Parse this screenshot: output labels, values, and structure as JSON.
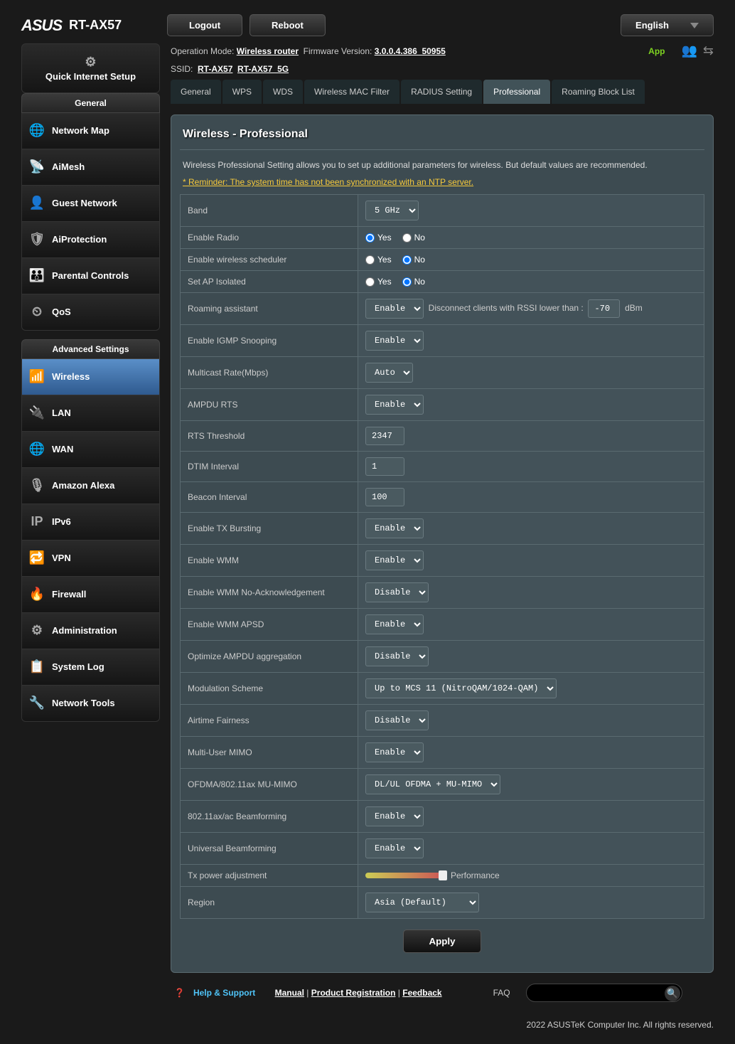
{
  "header": {
    "brand": "ASUS",
    "model": "RT-AX57",
    "logout": "Logout",
    "reboot": "Reboot",
    "language": "English"
  },
  "status": {
    "operation_mode_label": "Operation Mode:",
    "operation_mode": "Wireless router",
    "firmware_label": "Firmware Version:",
    "firmware": "3.0.0.4.386_50955",
    "ssid_label": "SSID:",
    "ssid1": "RT-AX57",
    "ssid2": "RT-AX57_5G",
    "app": "App"
  },
  "sidebar": {
    "qis": "Quick Internet Setup",
    "general_label": "General",
    "general": [
      {
        "label": "Network Map",
        "icon": "🌐"
      },
      {
        "label": "AiMesh",
        "icon": "📡"
      },
      {
        "label": "Guest Network",
        "icon": "👤"
      },
      {
        "label": "AiProtection",
        "icon": "🛡"
      },
      {
        "label": "Parental Controls",
        "icon": "👪"
      },
      {
        "label": "QoS",
        "icon": "⏲"
      }
    ],
    "advanced_label": "Advanced Settings",
    "advanced": [
      {
        "label": "Wireless",
        "icon": "📶",
        "active": true
      },
      {
        "label": "LAN",
        "icon": "🔌"
      },
      {
        "label": "WAN",
        "icon": "🌐"
      },
      {
        "label": "Amazon Alexa",
        "icon": "🎙"
      },
      {
        "label": "IPv6",
        "icon": "IP"
      },
      {
        "label": "VPN",
        "icon": "🔁"
      },
      {
        "label": "Firewall",
        "icon": "🔥"
      },
      {
        "label": "Administration",
        "icon": "⚙"
      },
      {
        "label": "System Log",
        "icon": "📋"
      },
      {
        "label": "Network Tools",
        "icon": "🔧"
      }
    ]
  },
  "tabs": [
    "General",
    "WPS",
    "WDS",
    "Wireless MAC Filter",
    "RADIUS Setting",
    "Professional",
    "Roaming Block List"
  ],
  "active_tab": 5,
  "panel": {
    "title": "Wireless - Professional",
    "description": "Wireless Professional Setting allows you to set up additional parameters for wireless. But default values are recommended.",
    "reminder": "* Reminder: The system time has not been synchronized with an NTP server."
  },
  "settings": {
    "band": {
      "label": "Band",
      "value": "5 GHz"
    },
    "enable_radio": {
      "label": "Enable Radio",
      "yes": "Yes",
      "no": "No",
      "value": "yes"
    },
    "enable_scheduler": {
      "label": "Enable wireless scheduler",
      "yes": "Yes",
      "no": "No",
      "value": "no"
    },
    "ap_isolated": {
      "label": "Set AP Isolated",
      "yes": "Yes",
      "no": "No",
      "value": "no"
    },
    "roaming": {
      "label": "Roaming assistant",
      "value": "Enable",
      "disconnect_text": "Disconnect clients with RSSI lower than :",
      "rssi": "-70",
      "unit": "dBm"
    },
    "igmp": {
      "label": "Enable IGMP Snooping",
      "value": "Enable"
    },
    "multicast": {
      "label": "Multicast Rate(Mbps)",
      "value": "Auto"
    },
    "ampdu_rts": {
      "label": "AMPDU RTS",
      "value": "Enable"
    },
    "rts_threshold": {
      "label": "RTS Threshold",
      "value": "2347"
    },
    "dtim": {
      "label": "DTIM Interval",
      "value": "1"
    },
    "beacon": {
      "label": "Beacon Interval",
      "value": "100"
    },
    "tx_bursting": {
      "label": "Enable TX Bursting",
      "value": "Enable"
    },
    "wmm": {
      "label": "Enable WMM",
      "value": "Enable"
    },
    "wmm_noack": {
      "label": "Enable WMM No-Acknowledgement",
      "value": "Disable"
    },
    "wmm_apsd": {
      "label": "Enable WMM APSD",
      "value": "Enable"
    },
    "ampdu_agg": {
      "label": "Optimize AMPDU aggregation",
      "value": "Disable"
    },
    "modulation": {
      "label": "Modulation Scheme",
      "value": "Up to MCS 11 (NitroQAM/1024-QAM)"
    },
    "airtime": {
      "label": "Airtime Fairness",
      "value": "Disable"
    },
    "mu_mimo": {
      "label": "Multi-User MIMO",
      "value": "Enable"
    },
    "ofdma": {
      "label": "OFDMA/802.11ax MU-MIMO",
      "value": "DL/UL OFDMA + MU-MIMO"
    },
    "beamforming": {
      "label": "802.11ax/ac Beamforming",
      "value": "Enable"
    },
    "universal_bf": {
      "label": "Universal Beamforming",
      "value": "Enable"
    },
    "tx_power": {
      "label": "Tx power adjustment",
      "value": "Performance"
    },
    "region": {
      "label": "Region",
      "value": "Asia (Default)"
    }
  },
  "apply": "Apply",
  "footer": {
    "help": "Help & Support",
    "manual": "Manual",
    "product_reg": "Product Registration",
    "feedback": "Feedback",
    "faq": "FAQ",
    "copyright": "2022 ASUSTeK Computer Inc. All rights reserved."
  }
}
